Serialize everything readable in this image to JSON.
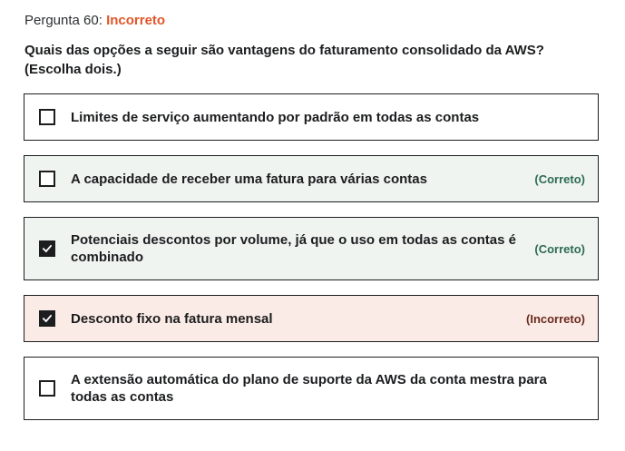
{
  "header": {
    "prefix": "Pergunta 60:",
    "status": "Incorreto"
  },
  "question": {
    "line1": "Quais das opções a seguir são vantagens do faturamento consolidado da AWS?",
    "line2": "(Escolha dois.)"
  },
  "options": [
    {
      "text": "Limites de serviço aumentando por padrão em todas as contas",
      "checked": false,
      "result": ""
    },
    {
      "text": "A capacidade de receber uma fatura para várias contas",
      "checked": false,
      "result": "(Correto)"
    },
    {
      "text": "Potenciais descontos por volume, já que o uso em todas as contas é combinado",
      "checked": true,
      "result": "(Correto)"
    },
    {
      "text": "Desconto fixo na fatura mensal",
      "checked": true,
      "result": "(Incorreto)"
    },
    {
      "text": "A extensão automática do plano de suporte da AWS da conta mestra para todas as contas",
      "checked": false,
      "result": ""
    }
  ],
  "colors": {
    "incorrect_accent": "#e2562a",
    "correct_bg": "#eff4f1",
    "incorrect_bg": "#fbebe6",
    "correct_label": "#2e6b53",
    "incorrect_label": "#6a2a1e"
  }
}
